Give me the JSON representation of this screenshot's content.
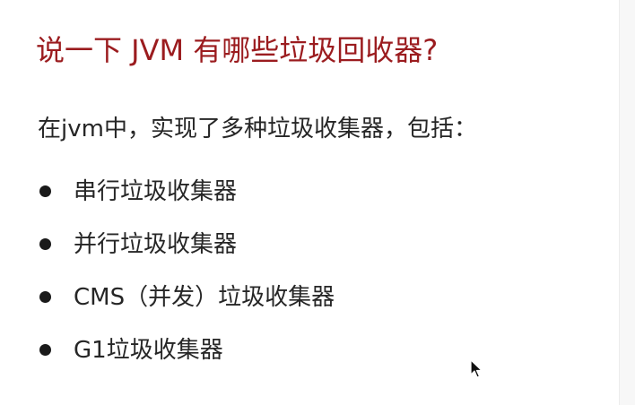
{
  "slide": {
    "title": "说一下 JVM 有哪些垃圾回收器?",
    "intro": "在jvm中，实现了多种垃圾收集器，包括：",
    "items": [
      {
        "label": "串行垃圾收集器"
      },
      {
        "label": "并行垃圾收集器"
      },
      {
        "label": "CMS（并发）垃圾收集器"
      },
      {
        "label": "G1垃圾收集器"
      }
    ]
  },
  "colors": {
    "title": "#9b1c1f",
    "body_text": "#262626",
    "bullet": "#1a1a1a",
    "background": "#ffffff"
  },
  "icons": {
    "cursor": "mouse-pointer-icon"
  }
}
